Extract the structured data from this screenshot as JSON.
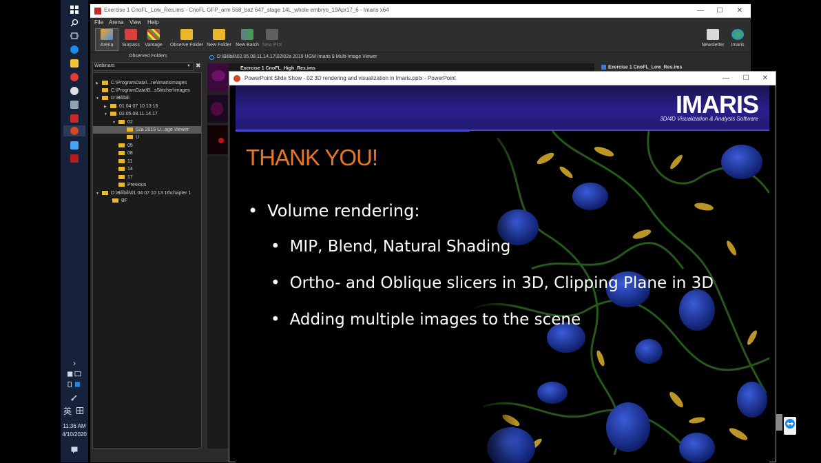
{
  "taskbar": {
    "time": "11:36 AM",
    "date": "4/10/2020",
    "ime": "英",
    "expand_glyph": "›"
  },
  "imaris": {
    "title": "Exercise 1 CnoFL_Low_Res.ims - CnoFL GFP_arm 568_baz 647_stage 14L_whole embryo_19Apr17_6 - Imaris x64",
    "menu": [
      "File",
      "Arena",
      "View",
      "Help"
    ],
    "toolbar": {
      "arena": "Arena",
      "surpass": "Surpass",
      "vantage": "Vantage",
      "observe_folder": "Observe Folder",
      "new_folder": "New Folder",
      "new_batch": "New Batch",
      "new_plot": "New Plot",
      "newsletter": "Newsletter",
      "imaris": "Imaris"
    },
    "observed_folders_label": "Observed Folders",
    "webinar_select": "Webinars",
    "tree": [
      "C:\\ProgramData\\...ne\\ImarisImages",
      "C:\\ProgramData\\B...sStitcher\\images",
      "D:\\Bilibili",
      "01 04 07 10 13 16",
      "02.05.08.11.14.17",
      "02",
      "02a 2019 U...age Viewer",
      "U",
      "05",
      "08",
      "11",
      "14",
      "17",
      "Previous",
      "D:\\Bilibili\\01 04 07 10 13 16\\chapter 1",
      "BF"
    ],
    "viewer_path": "D:\\Bilibili\\02.05.08.11.14.17\\02\\02a 2019 UGM Imaris 9 Multi-Image Viewer",
    "viewer_image_title": "Exercise 1 CnoFL_High_Res.ims",
    "right_image_title": "Exercise 1 CnoFL_Low_Res.ims"
  },
  "ppt": {
    "title": "PowerPoint Slide Show - 02 3D rendering and visualization in Imaris.pptx - PowerPoint",
    "logo_name": "IMARIS",
    "logo_sub": "3D/4D Visualization & Analysis Software",
    "heading": "THANK YOU!",
    "bullets": [
      "Volume rendering:",
      "MIP, Blend, Natural Shading",
      "Ortho- and Oblique slicers in 3D, Clipping Plane in 3D",
      "Adding multiple images to the scene"
    ],
    "bullet_glyph": "•"
  },
  "colors": {
    "heading": "#e87722",
    "banner": "#2a1f8a",
    "folder": "#e9b82a"
  }
}
